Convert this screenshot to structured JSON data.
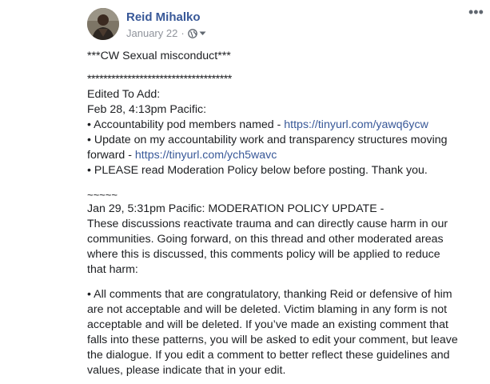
{
  "post": {
    "author": "Reid Mihalko",
    "date": "January 22",
    "separator": "·",
    "privacy_icon": "globe-icon",
    "privacy_dropdown_icon": "caret-down-icon",
    "more_label": "•••",
    "cw_line": "***CW Sexual misconduct***",
    "stars_line": "************************************",
    "edited_heading": "Edited To Add:",
    "edited_time": "Feb 28, 4:13pm Pacific:",
    "bullet1_text": "• Accountability pod members named - ",
    "bullet1_link": "https://tinyurl.com/yawq6ycw",
    "bullet2_line1": "• Update on my accountability work and transparency structures moving",
    "bullet2_line2": "forward - ",
    "bullet2_link": "https://tinyurl.com/ych5wavc",
    "bullet3_text": "• PLEASE read Moderation Policy below before posting. Thank you.",
    "tildes": "~~~~~",
    "mod_update": "Jan 29, 5:31pm Pacific: MODERATION POLICY UPDATE -",
    "para1_line1": "These discussions reactivate trauma and can directly cause harm in our",
    "para1_line2": "communities. Going forward, on this thread and other moderated areas",
    "para1_line3": "where this is discussed, this comments policy will be applied to reduce",
    "para1_line4": "that harm:",
    "para2_line1": "• All comments that are congratulatory, thanking Reid or defensive of him",
    "para2_line2": "are not acceptable and will be deleted. Victim blaming in any form is not",
    "para2_line3": "acceptable and will be deleted. If you’ve made an existing comment that",
    "para2_line4": "falls into these patterns, you will be asked to edit your comment, but leave",
    "para2_line5": "the dialogue. If you edit a comment to better reflect these guidelines and",
    "para2_line6": "values, please indicate that in your edit."
  },
  "colors": {
    "link": "#385898",
    "meta": "#90949c",
    "text": "#1c1e21"
  }
}
